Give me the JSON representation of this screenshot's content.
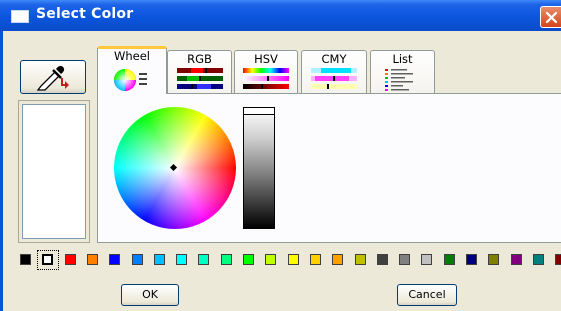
{
  "window": {
    "title": "Select Color"
  },
  "tabs": [
    {
      "label": "Wheel",
      "icon": "color-wheel-icon",
      "selected": true
    },
    {
      "label": "RGB",
      "icon": "rgb-sliders-icon",
      "selected": false
    },
    {
      "label": "HSV",
      "icon": "hsv-sliders-icon",
      "selected": false
    },
    {
      "label": "CMY",
      "icon": "cmy-sliders-icon",
      "selected": false
    },
    {
      "label": "List",
      "icon": "color-list-icon",
      "selected": false
    }
  ],
  "wheel": {
    "brightness": 1.0
  },
  "swatches": [
    "#000000",
    "#ffffff",
    "#ff0000",
    "#ff8000",
    "#0000ff",
    "#0080ff",
    "#00c0ff",
    "#00ffff",
    "#00ffc0",
    "#00ff80",
    "#00ff00",
    "#c0ff00",
    "#ffff00",
    "#ffd000",
    "#ffa000",
    "#c0c000",
    "#404040",
    "#808080",
    "#c0c0c0",
    "#008000",
    "#000080",
    "#808000",
    "#800080",
    "#008080",
    "#800000"
  ],
  "selected_swatch": 1,
  "buttons": {
    "ok": "OK",
    "cancel": "Cancel"
  }
}
